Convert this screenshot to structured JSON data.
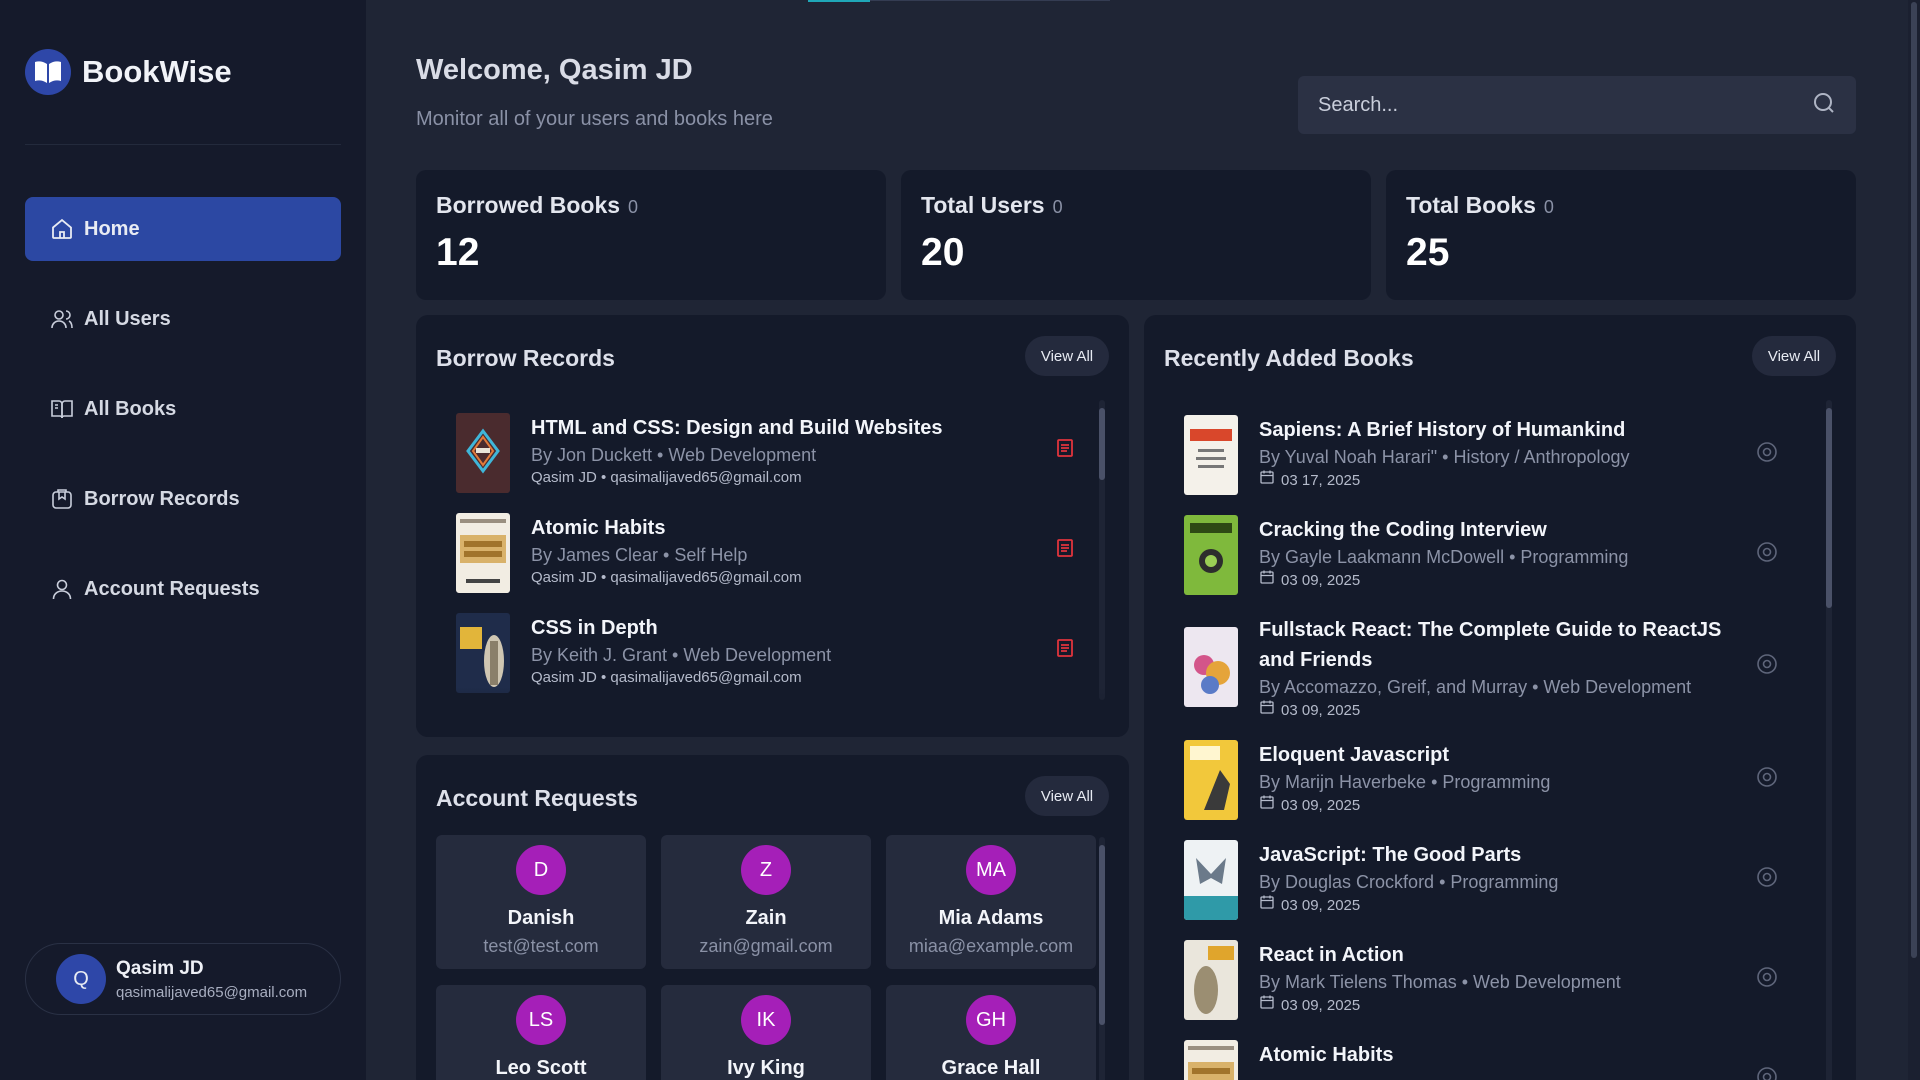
{
  "app": {
    "name": "BookWise"
  },
  "sidebar": {
    "items": [
      {
        "label": "Home",
        "icon": "home-icon",
        "active": true
      },
      {
        "label": "All Users",
        "icon": "users-icon",
        "active": false
      },
      {
        "label": "All Books",
        "icon": "book-open-icon",
        "active": false
      },
      {
        "label": "Borrow Records",
        "icon": "bookmark-icon",
        "active": false
      },
      {
        "label": "Account Requests",
        "icon": "user-icon",
        "active": false
      }
    ],
    "profile": {
      "initial": "Q",
      "name": "Qasim JD",
      "email": "qasimalijaved65@gmail.com"
    }
  },
  "header": {
    "welcome": "Welcome, Qasim JD",
    "subtitle": "Monitor all of your users and books here",
    "search_placeholder": "Search..."
  },
  "stats": [
    {
      "title": "Borrowed Books",
      "badge": "0",
      "value": "12"
    },
    {
      "title": "Total Users",
      "badge": "0",
      "value": "20"
    },
    {
      "title": "Total Books",
      "badge": "0",
      "value": "25"
    }
  ],
  "borrow_records": {
    "title": "Borrow Records",
    "view_all": "View All",
    "items": [
      {
        "title": "HTML and CSS: Design and Build Websites",
        "meta": "By Jon Duckett • Web Development",
        "sub": "Qasim JD • qasimalijaved65@gmail.com"
      },
      {
        "title": "Atomic Habits",
        "meta": "By James Clear • Self Help",
        "sub": "Qasim JD • qasimalijaved65@gmail.com"
      },
      {
        "title": "CSS in Depth",
        "meta": "By Keith J. Grant • Web Development",
        "sub": "Qasim JD • qasimalijaved65@gmail.com"
      }
    ]
  },
  "account_requests": {
    "title": "Account Requests",
    "view_all": "View All",
    "items": [
      {
        "initials": "D",
        "name": "Danish",
        "email": "test@test.com"
      },
      {
        "initials": "Z",
        "name": "Zain",
        "email": "zain@gmail.com"
      },
      {
        "initials": "MA",
        "name": "Mia Adams",
        "email": "miaa@example.com"
      },
      {
        "initials": "LS",
        "name": "Leo Scott",
        "email": ""
      },
      {
        "initials": "IK",
        "name": "Ivy King",
        "email": ""
      },
      {
        "initials": "GH",
        "name": "Grace Hall",
        "email": ""
      }
    ]
  },
  "recent_books": {
    "title": "Recently Added Books",
    "view_all": "View All",
    "items": [
      {
        "title": "Sapiens: A Brief History of Humankind",
        "meta": "By Yuval Noah Harari\" • History / Anthropology",
        "date": "03 17, 2025"
      },
      {
        "title": "Cracking the Coding Interview",
        "meta": "By Gayle Laakmann McDowell • Programming",
        "date": "03 09, 2025"
      },
      {
        "title": "Fullstack React: The Complete Guide to ReactJS and Friends",
        "meta": "By Accomazzo, Greif, and Murray • Web Development",
        "date": "03 09, 2025"
      },
      {
        "title": "Eloquent Javascript",
        "meta": "By Marijn Haverbeke • Programming",
        "date": "03 09, 2025"
      },
      {
        "title": "JavaScript: The Good Parts",
        "meta": "By Douglas Crockford • Programming",
        "date": "03 09, 2025"
      },
      {
        "title": "React in Action",
        "meta": "By Mark Tielens Thomas • Web Development",
        "date": "03 09, 2025"
      },
      {
        "title": "Atomic Habits",
        "meta": "",
        "date": ""
      }
    ]
  },
  "colors": {
    "accent": "#2c48a3",
    "background": "#1f2535",
    "panel": "#141a2a",
    "avatar": "#a51fb8",
    "danger": "#e0343c"
  }
}
